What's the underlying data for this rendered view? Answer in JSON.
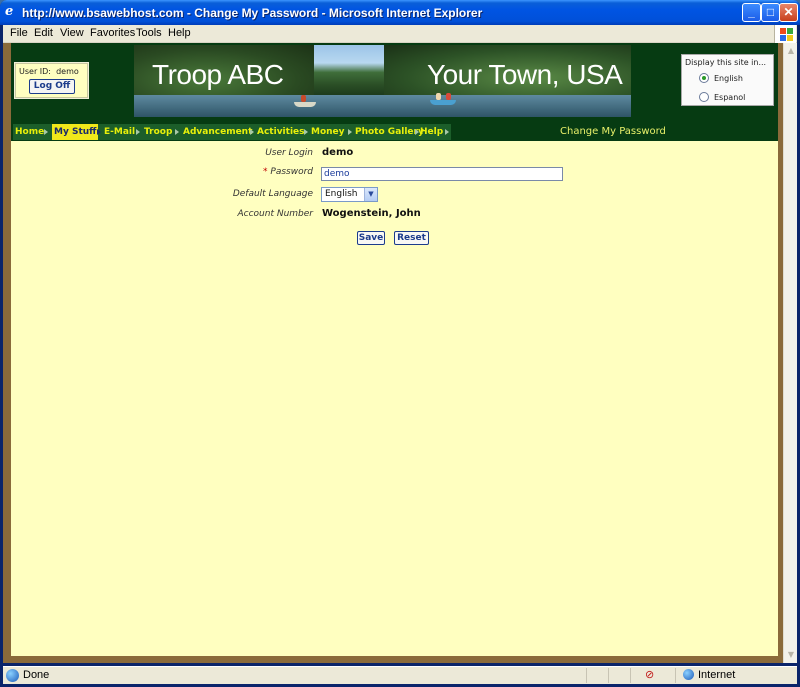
{
  "window": {
    "title": "http://www.bsawebhost.com - Change My Password - Microsoft Internet Explorer",
    "min": "_",
    "max": "□",
    "close": "✕"
  },
  "menu": [
    "File",
    "Edit",
    "View",
    "Favorites",
    "Tools",
    "Help"
  ],
  "header": {
    "user_id_label": "User ID:",
    "user_id": "demo",
    "logoff_label": "Log Off",
    "banner_left": "Troop ABC",
    "banner_right": "Your Town, USA",
    "lang_title": "Display this site in...",
    "lang_options": [
      {
        "label": "English",
        "checked": true
      },
      {
        "label": "Espanol",
        "checked": false
      }
    ]
  },
  "nav": {
    "items": [
      "Home",
      "My Stuff",
      "E-Mail",
      "Troop",
      "Advancement",
      "Activities",
      "Money",
      "Photo Gallery",
      "Help"
    ],
    "active": "My Stuff",
    "page_heading": "Change My Password"
  },
  "form": {
    "user_login_label": "User Login",
    "user_login_value": "demo",
    "password_required_mark": "*",
    "password_label": "Password",
    "password_value": "demo",
    "language_label": "Default Language",
    "language_value": "English",
    "account_label": "Account Number",
    "account_value": "Wogenstein, John",
    "save_label": "Save",
    "reset_label": "Reset"
  },
  "status": {
    "text": "Done",
    "zone": "Internet"
  },
  "colors": {
    "page_bg": "#ffffc0",
    "header_bg": "#063b12",
    "nav_text": "#e8f00a",
    "nav_active_bg": "#f0e81a"
  }
}
